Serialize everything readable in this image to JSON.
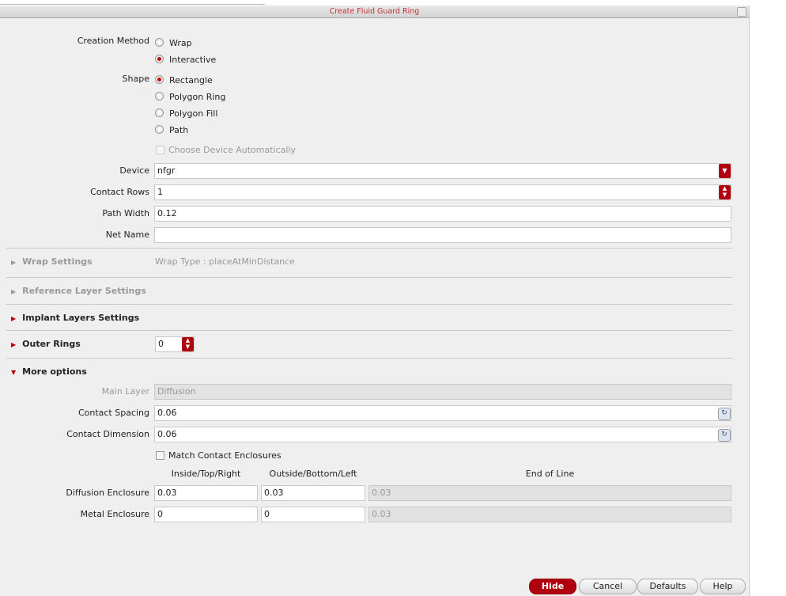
{
  "window": {
    "title": "Create Fluid Guard Ring"
  },
  "creation_method": {
    "label": "Creation Method",
    "options": [
      "Wrap",
      "Interactive"
    ],
    "selected": "Interactive"
  },
  "shape": {
    "label": "Shape",
    "options": [
      "Rectangle",
      "Polygon Ring",
      "Polygon Fill",
      "Path"
    ],
    "selected": "Rectangle"
  },
  "choose_device": {
    "label": "Choose Device Automatically",
    "checked": false,
    "disabled": true
  },
  "device": {
    "label": "Device",
    "value": "nfgr"
  },
  "contact_rows": {
    "label": "Contact Rows",
    "value": "1"
  },
  "path_width": {
    "label": "Path Width",
    "value": "0.12"
  },
  "net_name": {
    "label": "Net Name",
    "value": ""
  },
  "sections": {
    "wrap": "Wrap Settings",
    "wrap_type": "Wrap Type : placeAtMinDistance",
    "reference": "Reference Layer Settings",
    "implant": "Implant Layers Settings",
    "outer_rings": "Outer Rings",
    "outer_rings_value": "0",
    "more": "More options"
  },
  "more": {
    "main_layer": {
      "label": "Main Layer",
      "value": "Diffusion"
    },
    "contact_spacing": {
      "label": "Contact Spacing",
      "value": "0.06"
    },
    "contact_dimension": {
      "label": "Contact Dimension",
      "value": "0.06"
    },
    "match": {
      "label": "Match Contact Enclosures",
      "checked": false
    },
    "columns": [
      "Inside/Top/Right",
      "Outside/Bottom/Left",
      "End of Line"
    ],
    "rows": [
      {
        "label": "Diffusion Enclosure",
        "values": [
          "0.03",
          "0.03",
          "0.03"
        ]
      },
      {
        "label": "Metal Enclosure",
        "values": [
          "0",
          "0",
          "0.03"
        ]
      }
    ]
  },
  "buttons": {
    "hide": "Hide",
    "cancel": "Cancel",
    "defaults": "Defaults",
    "help": "Help"
  }
}
